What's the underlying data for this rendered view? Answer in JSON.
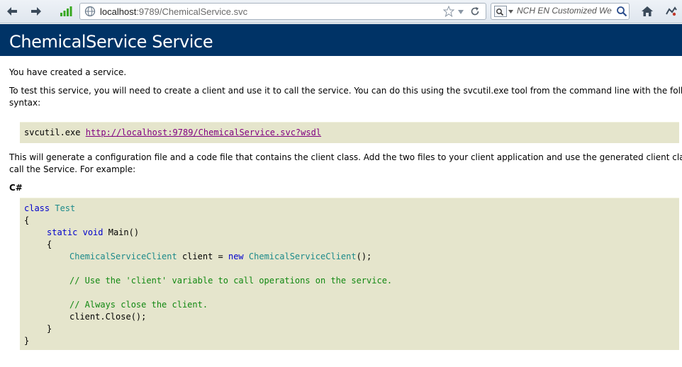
{
  "browser": {
    "url_host": "localhost",
    "url_rest": ":9789/ChemicalService.svc",
    "search_placeholder": "NCH EN Customized We"
  },
  "page": {
    "title": "ChemicalService Service",
    "p1": "You have created a service.",
    "p2_line1": "To test this service, you will need to create a client and use it to call the service. You can do this using the svcutil.exe tool from the command line with the following",
    "p2_line2": "syntax:",
    "svcutil_cmd": "svcutil.exe",
    "wsdl_link": "http://localhost:9789/ChemicalService.svc?wsdl",
    "p3_line1": "This will generate a configuration file and a code file that contains the client class. Add the two files to your client application and use the generated client class to",
    "p3_line2": "call the Service. For example:",
    "lang_label": "C#"
  },
  "code": {
    "l1_kw": "class",
    "l1_ty": "Test",
    "l2": "{",
    "l3_kw1": "static",
    "l3_kw2": "void",
    "l3_rest": "Main()",
    "l4": "{",
    "l5_ty1": "ChemicalServiceClient",
    "l5_mid": " client = ",
    "l5_kw": "new",
    "l5_ty2": "ChemicalServiceClient",
    "l5_end": "();",
    "l6": "// Use the 'client' variable to call operations on the service.",
    "l7": "// Always close the client.",
    "l8": "client.Close();",
    "l9": "}",
    "l10": "}"
  }
}
